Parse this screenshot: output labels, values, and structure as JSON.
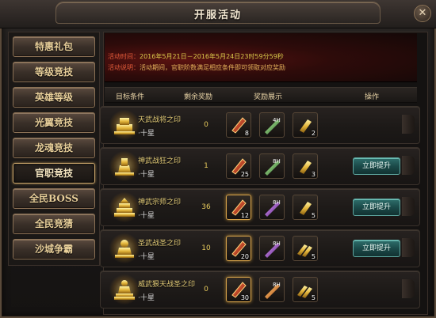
{
  "window": {
    "title": "开服活动",
    "close_label": "✕"
  },
  "sidebar": {
    "items": [
      {
        "label": "特惠礼包",
        "active": false
      },
      {
        "label": "等级竞技",
        "active": false
      },
      {
        "label": "英雄等级",
        "active": false
      },
      {
        "label": "光翼竞技",
        "active": false
      },
      {
        "label": "龙魂竞技",
        "active": false
      },
      {
        "label": "官职竞技",
        "active": true
      },
      {
        "label": "全民BOSS",
        "active": false
      },
      {
        "label": "全民竞猜",
        "active": false
      },
      {
        "label": "沙城争霸",
        "active": false
      }
    ]
  },
  "banner": {
    "time_label": "活动时间：",
    "time_value": "2016年5月21日－2016年5月24日23时59分59秒",
    "desc_label": "活动说明：",
    "desc_value": "活动期间，官职阶数满足相应条件即可领取对应奖励"
  },
  "table": {
    "headers": {
      "target": "目标条件",
      "remain": "剩余奖励",
      "reward": "奖励展示",
      "action": "操作"
    },
    "rows": [
      {
        "name": "天武战将之印",
        "star": "·十星",
        "remain": "0",
        "rewards": [
          {
            "icon": "red-scroll-icon",
            "count": "8",
            "tag": ""
          },
          {
            "icon": "green-wand-icon",
            "count": "",
            "tag": "4H"
          },
          {
            "icon": "gold-bar-icon",
            "count": "2",
            "tag": ""
          }
        ],
        "button": ""
      },
      {
        "name": "神武战狂之印",
        "star": "·十星",
        "remain": "1",
        "rewards": [
          {
            "icon": "red-scroll-icon",
            "count": "25",
            "tag": ""
          },
          {
            "icon": "green-wand-icon",
            "count": "",
            "tag": "8H"
          },
          {
            "icon": "gold-bar-icon",
            "count": "3",
            "tag": ""
          }
        ],
        "button": "立即提升"
      },
      {
        "name": "神武宗师之印",
        "star": "·十星",
        "remain": "36",
        "rewards": [
          {
            "icon": "red-scroll-icon",
            "count": "12",
            "tag": ""
          },
          {
            "icon": "purple-scroll-icon",
            "count": "",
            "tag": "8H"
          },
          {
            "icon": "gold-bar-icon",
            "count": "5",
            "tag": ""
          }
        ],
        "button": "立即提升"
      },
      {
        "name": "圣武战圣之印",
        "star": "·十星",
        "remain": "10",
        "rewards": [
          {
            "icon": "red-scroll-icon",
            "count": "20",
            "tag": ""
          },
          {
            "icon": "purple-scroll-icon",
            "count": "",
            "tag": "8H"
          },
          {
            "icon": "gold-bar-stack-icon",
            "count": "5",
            "tag": ""
          }
        ],
        "button": "立即提升"
      },
      {
        "name": "威武狠天战圣之印",
        "star": "·十星",
        "remain": "0",
        "rewards": [
          {
            "icon": "red-scroll-icon",
            "count": "30",
            "tag": ""
          },
          {
            "icon": "orange-scroll-icon",
            "count": "",
            "tag": "8H"
          },
          {
            "icon": "gold-bar-stack-icon",
            "count": "5",
            "tag": ""
          }
        ],
        "button": ""
      }
    ]
  },
  "colors": {
    "accent_gold": "#e8cf9a",
    "banner_red": "#5a1210",
    "button_teal": "#2f6f6c"
  }
}
